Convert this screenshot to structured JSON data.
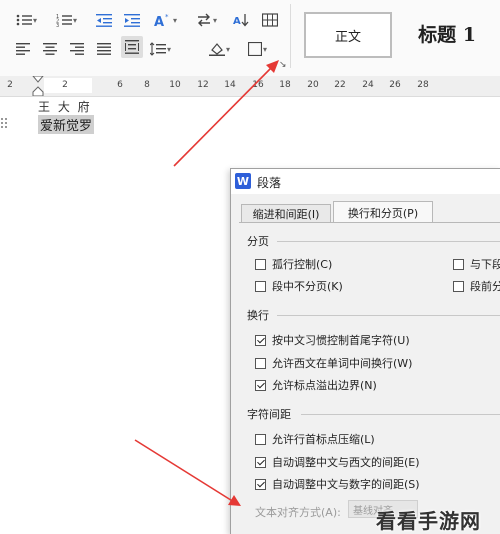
{
  "ribbon": {
    "row1_icons": [
      "bullet-list-icon",
      "numbered-list-icon",
      "decrease-indent-icon",
      "increase-indent-icon",
      "text-effects-icon",
      "line-spacing-icon",
      "sort-icon",
      "table-icon"
    ],
    "row2_icons": [
      "align-left-icon",
      "align-center-icon",
      "align-right-icon",
      "justify-icon",
      "distributed-icon",
      "paragraph-spacing-icon",
      "shading-icon",
      "border-icon"
    ],
    "styles": {
      "normal": "正文",
      "heading1": "标题 1"
    },
    "launcher": "↘"
  },
  "ruler": {
    "numbers": [
      "2",
      "2",
      "6",
      "8",
      "10",
      "12",
      "14",
      "16",
      "18",
      "20",
      "22",
      "24",
      "26",
      "28"
    ]
  },
  "document": {
    "line1": "王 大 府",
    "line2": "爱新觉罗"
  },
  "dialog": {
    "app_icon": "W",
    "title": "段落",
    "tabs": [
      "缩进和间距(I)",
      "换行和分页(P)"
    ],
    "sections": {
      "pagination": "分页",
      "line_break": "换行",
      "char_spacing": "字符间距"
    },
    "pagination": {
      "left": [
        {
          "label": "孤行控制(C)",
          "checked": false
        },
        {
          "label": "段中不分页(K)",
          "checked": false
        }
      ],
      "right": [
        {
          "label": "与下段",
          "checked": false
        },
        {
          "label": "段前分",
          "checked": false
        }
      ]
    },
    "line_break_options": [
      {
        "label": "按中文习惯控制首尾字符(U)",
        "checked": true
      },
      {
        "label": "允许西文在单词中间换行(W)",
        "checked": false
      },
      {
        "label": "允许标点溢出边界(N)",
        "checked": true
      }
    ],
    "char_spacing_options": [
      {
        "label": "允许行首标点压缩(L)",
        "checked": false
      },
      {
        "label": "自动调整中文与西文的间距(E)",
        "checked": true
      },
      {
        "label": "自动调整中文与数字的间距(S)",
        "checked": true
      }
    ],
    "text_alignment": {
      "label": "文本对齐方式(A):",
      "value": "基线对齐"
    }
  },
  "watermark": "看看手游网",
  "colors": {
    "arrow": "#e53935",
    "wps_blue": "#2e5fd9"
  }
}
